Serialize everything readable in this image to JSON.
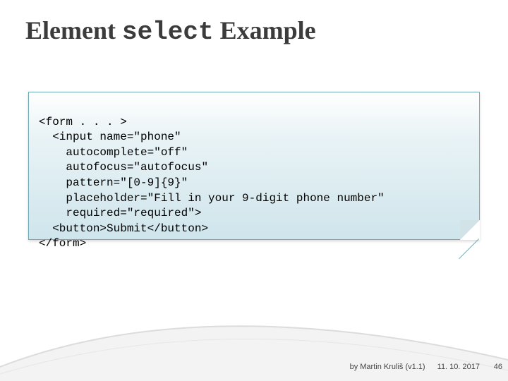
{
  "title": {
    "word1": "Element ",
    "mono": "select",
    "word2": " Example"
  },
  "code": "<form . . . >\n  <input name=\"phone\"\n    autocomplete=\"off\"\n    autofocus=\"autofocus\"\n    pattern=\"[0-9]{9}\"\n    placeholder=\"Fill in your 9-digit phone number\"\n    required=\"required\">\n  <button>Submit</button>\n</form>",
  "footer": {
    "author": "by Martin Kruliš (v1.1)",
    "date": "11. 10. 2017"
  },
  "page_number": "46"
}
